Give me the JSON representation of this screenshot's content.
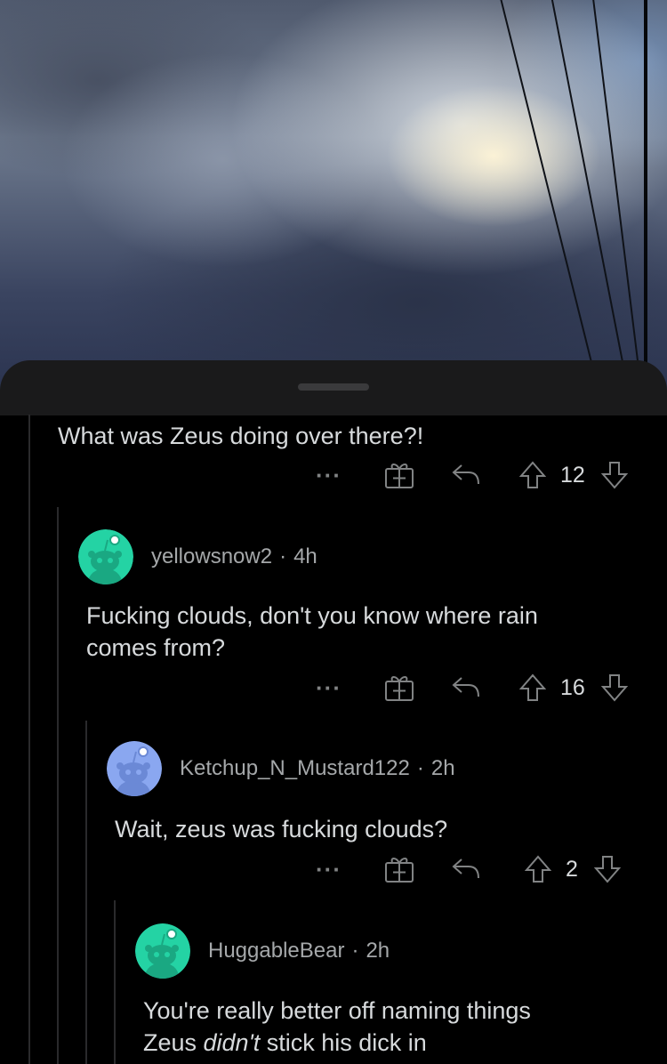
{
  "comments": [
    {
      "body": "What was Zeus doing over there?!",
      "score": "12"
    },
    {
      "username": "yellowsnow2",
      "age": "4h",
      "body_lines": [
        "Fucking clouds, don't you know where rain",
        "comes from?"
      ],
      "score": "16",
      "avatar_color": "#24d3a4"
    },
    {
      "username": "Ketchup_N_Mustard122",
      "age": "2h",
      "body": "Wait, zeus was fucking clouds?",
      "score": "2",
      "avatar_color": "#8aa7f0"
    },
    {
      "username": "HuggableBear",
      "age": "2h",
      "body_line1": "You're really better off naming things",
      "body_line2_pre": "Zeus ",
      "body_line2_em": "didn't",
      "body_line2_post": " stick his dick in",
      "avatar_color": "#24d3a4"
    }
  ],
  "separator": "·",
  "more_label": "···",
  "icons": [
    "more-icon",
    "award-icon",
    "reply-icon",
    "upvote-icon",
    "downvote-icon",
    "snoo-avatar-icon"
  ]
}
